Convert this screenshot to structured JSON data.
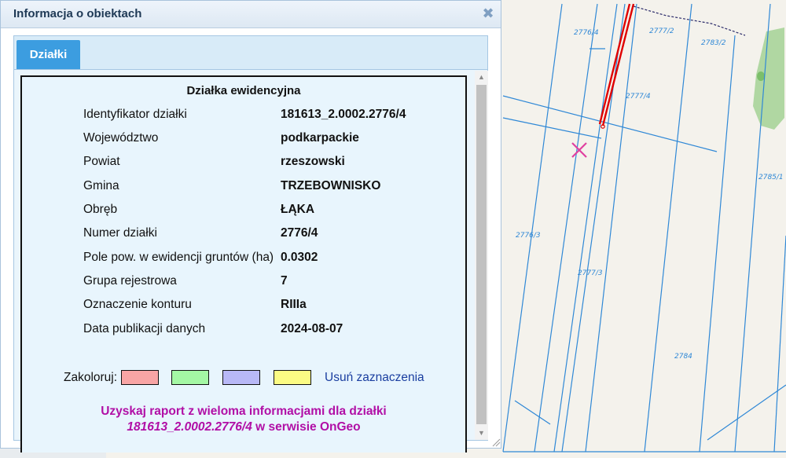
{
  "panel": {
    "title": "Informacja o obiektach",
    "close_icon": "close-icon",
    "tab_label": "Działki"
  },
  "parcel": {
    "title": "Działka ewidencyjna",
    "rows": [
      {
        "label": "Identyfikator działki",
        "value": "181613_2.0002.2776/4"
      },
      {
        "label": "Województwo",
        "value": "podkarpackie"
      },
      {
        "label": "Powiat",
        "value": "rzeszowski"
      },
      {
        "label": "Gmina",
        "value": "TRZEBOWNISKO"
      },
      {
        "label": "Obręb",
        "value": "ŁĄKA"
      },
      {
        "label": "Numer działki",
        "value": "2776/4"
      },
      {
        "label": "Pole pow. w ewidencji gruntów (ha)",
        "value": "0.0302"
      },
      {
        "label": "Grupa rejestrowa",
        "value": "7"
      },
      {
        "label": "Oznaczenie konturu",
        "value": "RIIIa"
      },
      {
        "label": "Data publikacji danych",
        "value": "2024-08-07"
      }
    ]
  },
  "colorize": {
    "label": "Zakoloruj:",
    "swatches": [
      "#f8a5a5",
      "#a4f7a4",
      "#b8b8f6",
      "#fbfb84"
    ],
    "clear_label": "Usuń zaznaczenia"
  },
  "report": {
    "line1": "Uzyskaj raport z wieloma informacjami dla działki",
    "line2_id": "181613_2.0002.2776/4",
    "line2_rest": " w serwisie OnGeo"
  },
  "map": {
    "labels": [
      "2776/4",
      "2777/2",
      "2783/2",
      "2777/4",
      "2785/1",
      "2776/3",
      "2777/3",
      "2784"
    ],
    "line_color": "#2f88d6",
    "highlight_color": "#e00000",
    "marker_color": "#e040a0",
    "green_color": "#a8d49a"
  }
}
